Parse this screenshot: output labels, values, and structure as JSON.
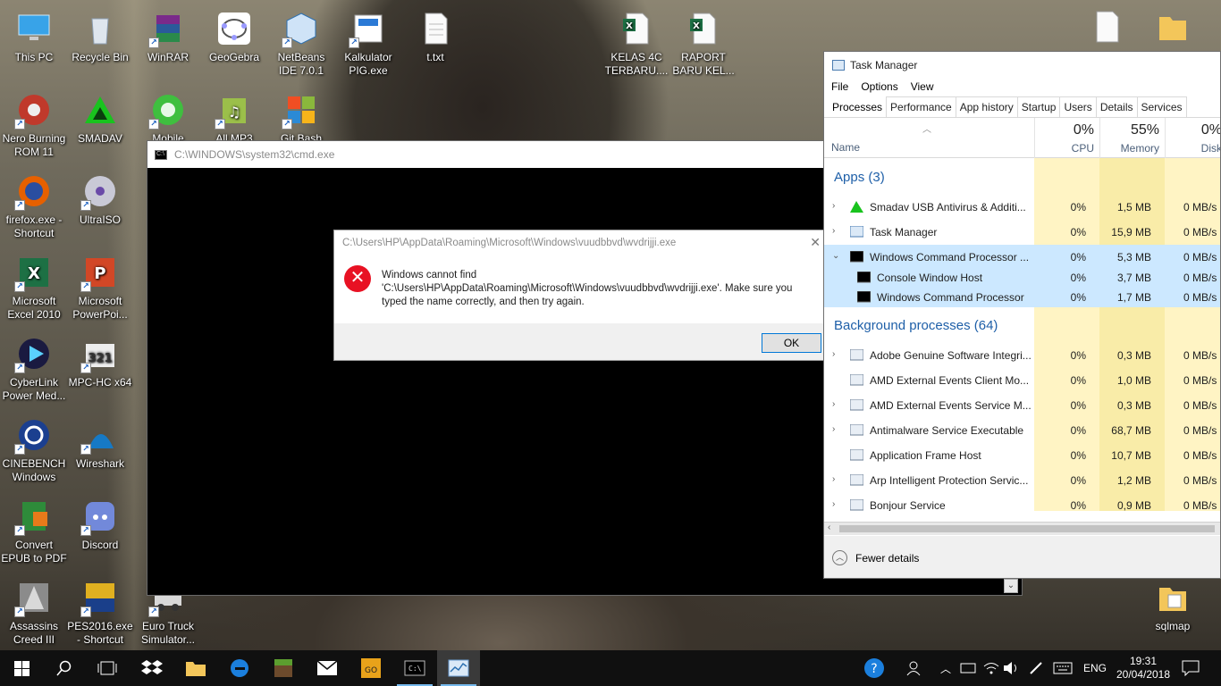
{
  "desktop": {
    "icons": [
      {
        "label": "This PC"
      },
      {
        "label": "Recycle Bin"
      },
      {
        "label": "WinRAR"
      },
      {
        "label": "GeoGebra"
      },
      {
        "label": "NetBeans IDE 7.0.1"
      },
      {
        "label": "Kalkulator PIG.exe"
      },
      {
        "label": "t.txt"
      },
      {
        "label": "KELAS 4C TERBARU...."
      },
      {
        "label": "RAPORT BARU KEL..."
      },
      {
        "label": "Nero Burning ROM 11"
      },
      {
        "label": "SMADAV"
      },
      {
        "label": "Mobile"
      },
      {
        "label": "All MP3"
      },
      {
        "label": "Git Bash"
      },
      {
        "label": "firefox.exe - Shortcut"
      },
      {
        "label": "UltraISO"
      },
      {
        "label": "Microsoft Excel 2010"
      },
      {
        "label": "Microsoft PowerPoi..."
      },
      {
        "label": "CyberLink Power Med..."
      },
      {
        "label": "MPC-HC x64"
      },
      {
        "label": "CINEBENCH Windows"
      },
      {
        "label": "Wireshark"
      },
      {
        "label": "Convert EPUB to PDF"
      },
      {
        "label": "Discord"
      },
      {
        "label": "Assassins Creed III"
      },
      {
        "label": "PES2016.exe - Shortcut"
      },
      {
        "label": "Euro Truck Simulator..."
      },
      {
        "label": "sqlmap"
      }
    ]
  },
  "cmd": {
    "title": "C:\\WINDOWS\\system32\\cmd.exe"
  },
  "dialog": {
    "title": "C:\\Users\\HP\\AppData\\Roaming\\Microsoft\\Windows\\vuudbbvd\\wvdrijji.exe",
    "line1": "Windows cannot find",
    "line2": "'C:\\Users\\HP\\AppData\\Roaming\\Microsoft\\Windows\\vuudbbvd\\wvdrijji.exe'. Make sure you",
    "line3": "typed the name correctly, and then try again.",
    "ok_label": "OK"
  },
  "task_manager": {
    "title": "Task Manager",
    "menu": [
      "File",
      "Options",
      "View"
    ],
    "tabs": [
      "Processes",
      "Performance",
      "App history",
      "Startup",
      "Users",
      "Details",
      "Services"
    ],
    "header": {
      "name_label": "Name",
      "cpu_pct": "0%",
      "cpu_label": "CPU",
      "mem_pct": "55%",
      "mem_label": "Memory",
      "disk_pct": "0%",
      "disk_label": "Disk"
    },
    "groups": {
      "apps": "Apps (3)",
      "background": "Background processes (64)"
    },
    "rows": [
      {
        "name": "Smadav USB Antivirus & Additi...",
        "cpu": "0%",
        "mem": "1,5 MB",
        "disk": "0 MB/s"
      },
      {
        "name": "Task Manager",
        "cpu": "0%",
        "mem": "15,9 MB",
        "disk": "0 MB/s"
      },
      {
        "name": "Windows Command Processor ...",
        "cpu": "0%",
        "mem": "5,3 MB",
        "disk": "0 MB/s"
      },
      {
        "name": "Console Window Host",
        "cpu": "0%",
        "mem": "3,7 MB",
        "disk": "0 MB/s"
      },
      {
        "name": "Windows Command Processor",
        "cpu": "0%",
        "mem": "1,7 MB",
        "disk": "0 MB/s"
      },
      {
        "name": "Adobe Genuine Software Integri...",
        "cpu": "0%",
        "mem": "0,3 MB",
        "disk": "0 MB/s"
      },
      {
        "name": "AMD External Events Client Mo...",
        "cpu": "0%",
        "mem": "1,0 MB",
        "disk": "0 MB/s"
      },
      {
        "name": "AMD External Events Service M...",
        "cpu": "0%",
        "mem": "0,3 MB",
        "disk": "0 MB/s"
      },
      {
        "name": "Antimalware Service Executable",
        "cpu": "0%",
        "mem": "68,7 MB",
        "disk": "0 MB/s"
      },
      {
        "name": "Application Frame Host",
        "cpu": "0%",
        "mem": "10,7 MB",
        "disk": "0 MB/s"
      },
      {
        "name": "Arp Intelligent Protection Servic...",
        "cpu": "0%",
        "mem": "1,2 MB",
        "disk": "0 MB/s"
      },
      {
        "name": "Bonjour Service",
        "cpu": "0%",
        "mem": "0,9 MB",
        "disk": "0 MB/s"
      }
    ],
    "fewer_details": "Fewer details"
  },
  "taskbar": {
    "lang": "ENG",
    "time": "19:31",
    "date": "20/04/2018"
  },
  "colors": {
    "accent": "#0078d7",
    "highlight_col": "#fff4c4",
    "selected_row": "#cce8ff",
    "error": "#e81123",
    "group_text": "#1e5fa8"
  }
}
